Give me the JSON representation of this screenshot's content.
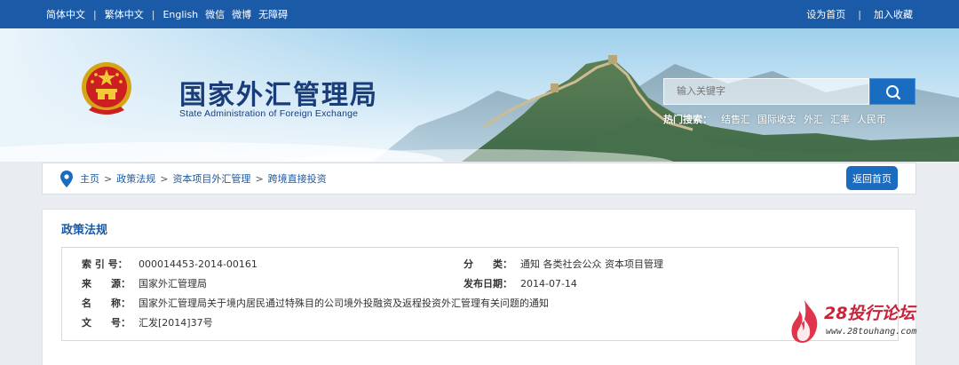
{
  "topbar": {
    "links": [
      "简体中文",
      "繁体中文",
      "English",
      "微信",
      "微博",
      "无障碍"
    ],
    "right_links": [
      "设为首页",
      "加入收藏"
    ]
  },
  "header": {
    "title": "国家外汇管理局",
    "subtitle": "State Administration of Foreign Exchange",
    "search_placeholder": "输入关键字",
    "hot_label": "热门搜索：",
    "hot_keywords": [
      "结售汇",
      "国际收支",
      "外汇",
      "汇率",
      "人民币"
    ]
  },
  "breadcrumb": {
    "items": [
      "主页",
      "政策法规",
      "资本项目外汇管理",
      "跨境直接投资"
    ],
    "back_label": "返回首页"
  },
  "main": {
    "section_title": "政策法规",
    "fields": {
      "index_label": "索 引 号：",
      "index_value": "000014453-2014-00161",
      "category_label": "分　　类：",
      "category_value": "通知  各类社会公众  资本项目管理",
      "source_label": "来　　源：",
      "source_value": "国家外汇管理局",
      "date_label": "发布日期：",
      "date_value": "2014-07-14",
      "name_label": "名　　称：",
      "name_value": "国家外汇管理局关于境内居民通过特殊目的公司境外投融资及返程投资外汇管理有关问题的通知",
      "doc_label": "文　　号：",
      "doc_value": "汇发[2014]37号"
    }
  },
  "watermark": {
    "brand": "28投行论坛",
    "url": "www.28touhang.com"
  },
  "colors": {
    "primary": "#1a5aa6",
    "button": "#1a6cc0",
    "watermark": "#c8233b"
  }
}
